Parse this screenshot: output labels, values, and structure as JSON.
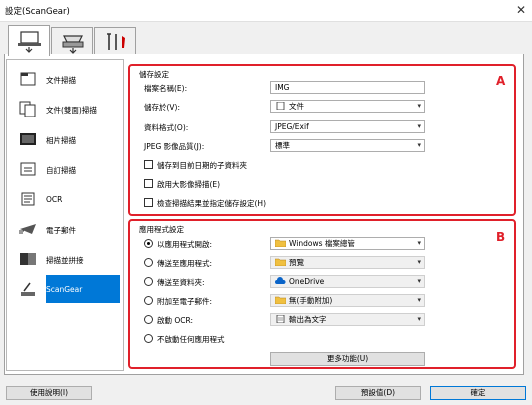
{
  "window": {
    "title": "設定(ScanGear)",
    "close_glyph": "✕"
  },
  "tabs": [
    {
      "name": "scan-from-computer",
      "icon": "computer-scan-icon",
      "active": true
    },
    {
      "name": "scan-from-panel",
      "icon": "panel-scan-icon",
      "active": false
    },
    {
      "name": "general-settings",
      "icon": "tools-icon",
      "active": false
    }
  ],
  "sidebar": {
    "items": [
      {
        "label": "文件掃描",
        "icon": "document-scan-icon"
      },
      {
        "label": "文件(雙面)掃描",
        "icon": "duplex-scan-icon"
      },
      {
        "label": "相片掃描",
        "icon": "photo-scan-icon"
      },
      {
        "label": "自訂掃描",
        "icon": "custom-scan-icon"
      },
      {
        "label": "OCR",
        "icon": "ocr-icon"
      },
      {
        "label": "電子郵件",
        "icon": "email-icon"
      },
      {
        "label": "掃描並拼接",
        "icon": "stitch-icon"
      },
      {
        "label": "ScanGear",
        "icon": "scangear-icon",
        "active": true
      }
    ]
  },
  "save_settings": {
    "title": "儲存設定",
    "marker": "A",
    "file_name": {
      "label": "檔案名稱(E):",
      "value": "IMG"
    },
    "save_in": {
      "label": "儲存於(V):",
      "value": "文件"
    },
    "data_format": {
      "label": "資料格式(O):",
      "value": "JPEG/Exif"
    },
    "jpeg_quality": {
      "label": "JPEG 影像品質(J):",
      "value": "標準"
    },
    "checkboxes": [
      {
        "label": "儲存到目前日期的子資料夾",
        "checked": false
      },
      {
        "label": "啟用大影像掃描(E)",
        "checked": false
      },
      {
        "label": "檢查掃描結果並指定儲存設定(H)",
        "checked": false
      }
    ]
  },
  "app_settings": {
    "title": "應用程式設定",
    "marker": "B",
    "options": [
      {
        "label": "以應用程式開啟:",
        "value": "Windows 檔案總管",
        "selected": true,
        "icon": "folder-icon",
        "enabled": true
      },
      {
        "label": "傳送至應用程式:",
        "value": "預覽",
        "selected": false,
        "icon": "folder-icon",
        "enabled": false
      },
      {
        "label": "傳送至資料夾:",
        "value": "OneDrive",
        "selected": false,
        "icon": "cloud-icon",
        "enabled": false
      },
      {
        "label": "附加至電子郵件:",
        "value": "無(手動附加)",
        "selected": false,
        "icon": "folder-icon",
        "enabled": false
      },
      {
        "label": "啟動 OCR:",
        "value": "輸出為文字",
        "selected": false,
        "icon": "ocr-icon",
        "enabled": false
      },
      {
        "label": "不啟動任何應用程式",
        "selected": false
      }
    ],
    "more_functions": "更多功能(U)"
  },
  "footer": {
    "help": "使用說明(I)",
    "defaults": "預設值(D)",
    "ok": "確定"
  },
  "colors": {
    "accent": "#0078d7",
    "highlight_box": "#e0202a"
  }
}
